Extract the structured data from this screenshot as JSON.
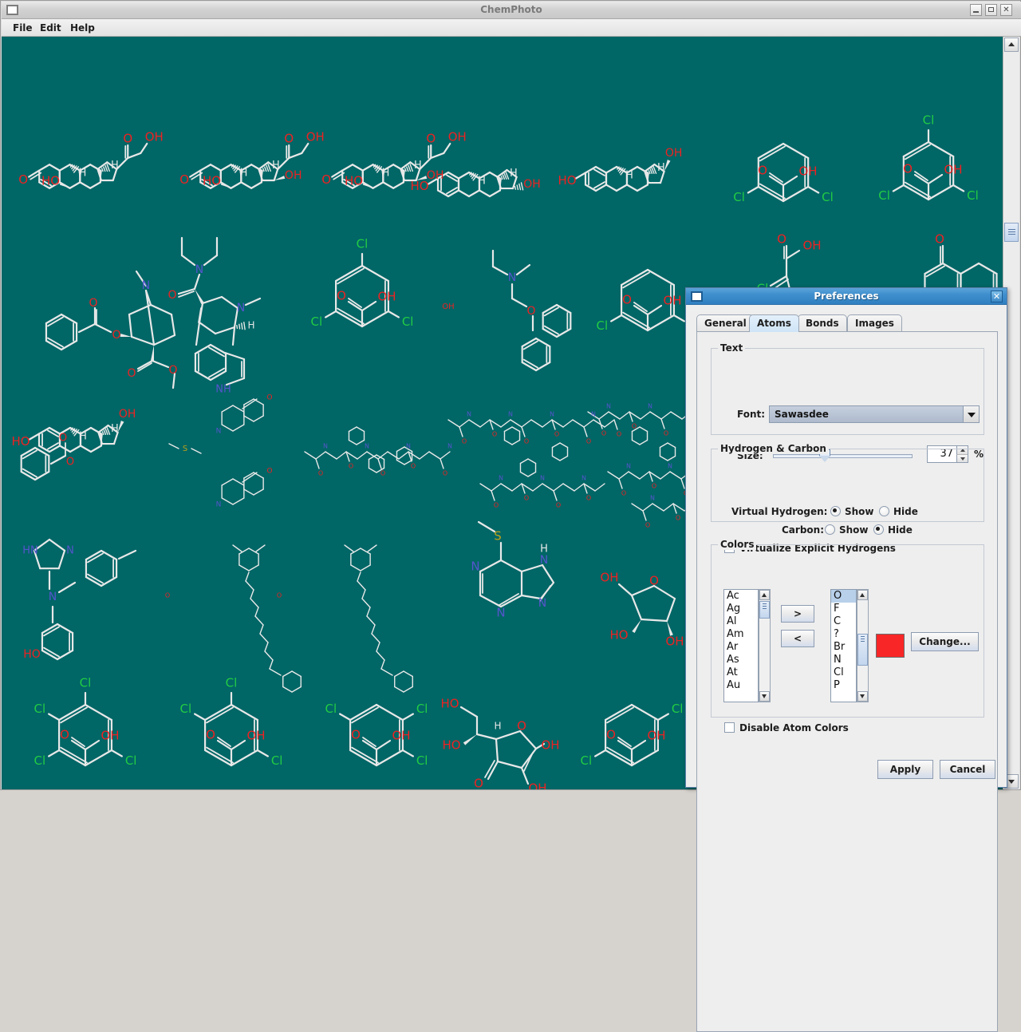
{
  "window": {
    "title": "ChemPhoto",
    "icon": "window-icon",
    "controls": {
      "minimize": "minimize-button",
      "maximize": "maximize-button",
      "close": "close-button"
    },
    "menu": [
      {
        "label": "File"
      },
      {
        "label": "Edit"
      },
      {
        "label": "Help"
      }
    ]
  },
  "canvas": {
    "background_color": "#006666",
    "bond_color": "#e8e8e8",
    "atom_colors": {
      "O": "#ee2222",
      "Cl": "#22cc44",
      "N": "#5555cc",
      "S": "#bba11a",
      "H": "#e8e8e8",
      "C": "#e8e8e8"
    }
  },
  "scrollbar": {
    "up_arrow": "scroll-up-arrow",
    "down_arrow": "scroll-down-arrow",
    "thumb": "scroll-thumb"
  },
  "dialog": {
    "title": "Preferences",
    "close_label": "✕",
    "tabs": [
      {
        "label": "General",
        "selected": false
      },
      {
        "label": "Atoms",
        "selected": true
      },
      {
        "label": "Bonds",
        "selected": false
      },
      {
        "label": "Images",
        "selected": false
      }
    ],
    "text_group": {
      "title": "Text",
      "font_label": "Font:",
      "font_value": "Sawasdee",
      "size_label": "Size:",
      "size_value": "37",
      "size_unit": "%"
    },
    "hydrogen_group": {
      "title": "Hydrogen & Carbon",
      "virtual_hydrogen_label": "Virtual Hydrogen:",
      "virtual_hydrogen_show": "Show",
      "virtual_hydrogen_hide": "Hide",
      "virtual_hydrogen_value": "Show",
      "carbon_label": "Carbon:",
      "carbon_show": "Show",
      "carbon_hide": "Hide",
      "carbon_value": "Hide",
      "virtualize_label": "Virtualize Explicit Hydrogens",
      "virtualize_checked": true
    },
    "colors_group": {
      "title": "Colors",
      "available_items": [
        "Ac",
        "Ag",
        "Al",
        "Am",
        "Ar",
        "As",
        "At",
        "Au"
      ],
      "selected_items": [
        "O",
        "F",
        "C",
        "?",
        "Br",
        "N",
        "Cl",
        "P"
      ],
      "selected_item_value": "O",
      "add_label": ">",
      "remove_label": "<",
      "swatch_color": "#f82626",
      "change_label": "Change...",
      "disable_label": "Disable Atom Colors",
      "disable_checked": false
    },
    "buttons": {
      "apply": "Apply",
      "cancel": "Cancel"
    }
  }
}
